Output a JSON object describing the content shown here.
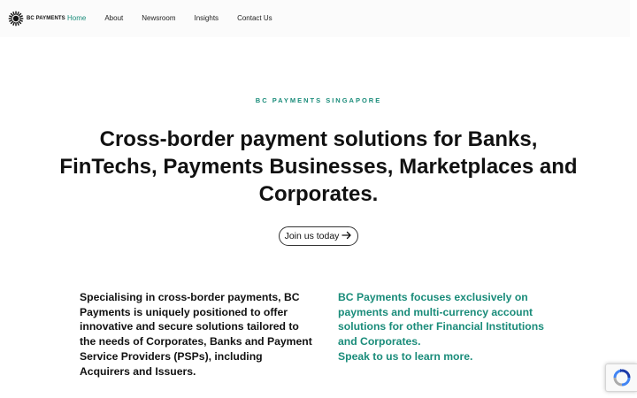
{
  "header": {
    "logo_text": "BC PAYMENTS",
    "nav": [
      "Home",
      "About",
      "Newsroom",
      "Insights",
      "Contact Us"
    ],
    "active_nav": "Home"
  },
  "hero": {
    "eyebrow": "BC PAYMENTS SINGAPORE",
    "headline": "Cross-border payment solutions for Banks, FinTechs, Payments Businesses, Marketplaces and Corporates.",
    "cta_label": "Join us today",
    "cta_icon": "arrow-right-icon"
  },
  "columns": {
    "left": "Specialising in cross-border payments, BC Payments is uniquely positioned to offer innovative and secure solutions tailored to the needs of Corporates, Banks and Payment Service Providers (PSPs), including Acquirers and Issuers.",
    "right_line1": "BC Payments focuses exclusively on payments and multi-currency account solutions for other Financial Institutions and Corporates.",
    "right_line2": "Speak to us to learn more."
  },
  "colors": {
    "accent": "#1a8c7a",
    "text": "#111111",
    "header_bg": "#fbfbfb"
  },
  "widgets": {
    "recaptcha_icon": "recaptcha-icon"
  }
}
